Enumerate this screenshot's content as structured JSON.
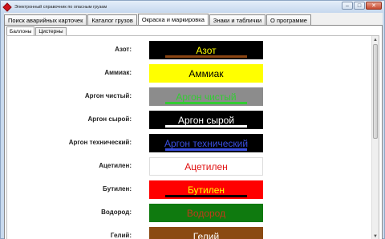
{
  "window": {
    "title": "Электронный справочник по опасным грузам",
    "controls": {
      "minimize": "–",
      "maximize": "□",
      "close": "✕"
    }
  },
  "tabs": [
    {
      "label": "Поиск аварийных карточек",
      "active": false
    },
    {
      "label": "Каталог грузов",
      "active": false
    },
    {
      "label": "Окраска и маркировка",
      "active": true
    },
    {
      "label": "Знаки и таблички",
      "active": false
    },
    {
      "label": "О программе",
      "active": false
    }
  ],
  "subtabs": [
    {
      "label": "Баллоны",
      "active": true
    },
    {
      "label": "Цистерны",
      "active": false
    }
  ],
  "rows": [
    {
      "label": "Азот:",
      "swatch_text": "Азот",
      "bg": "#000000",
      "text_color": "#ffff00",
      "stripe": "#8b4513"
    },
    {
      "label": "Аммиак:",
      "swatch_text": "Аммиак",
      "bg": "#ffff00",
      "text_color": "#000000",
      "stripe": null
    },
    {
      "label": "Аргон чистый:",
      "swatch_text": "Аргон чистый",
      "bg": "#8c8c8c",
      "text_color": "#33cc33",
      "stripe": "#33cc33"
    },
    {
      "label": "Аргон сырой:",
      "swatch_text": "Аргон сырой",
      "bg": "#000000",
      "text_color": "#ffffff",
      "stripe": "#ffffff"
    },
    {
      "label": "Аргон технический:",
      "swatch_text": "Аргон технический",
      "bg": "#000000",
      "text_color": "#3a4fe0",
      "stripe": "#3a4fe0"
    },
    {
      "label": "Ацетилен:",
      "swatch_text": "Ацетилен",
      "bg": "#ffffff",
      "text_color": "#e01010",
      "stripe": null
    },
    {
      "label": "Бутилен:",
      "swatch_text": "Бутилен",
      "bg": "#ff0000",
      "text_color": "#ffff00",
      "stripe": "#000000"
    },
    {
      "label": "Водород:",
      "swatch_text": "Водород",
      "bg": "#0f7a0f",
      "text_color": "#c23a1a",
      "stripe": null
    },
    {
      "label": "Гелий:",
      "swatch_text": "Гелий",
      "bg": "#8b4a12",
      "text_color": "#ffffff",
      "stripe": null
    }
  ]
}
